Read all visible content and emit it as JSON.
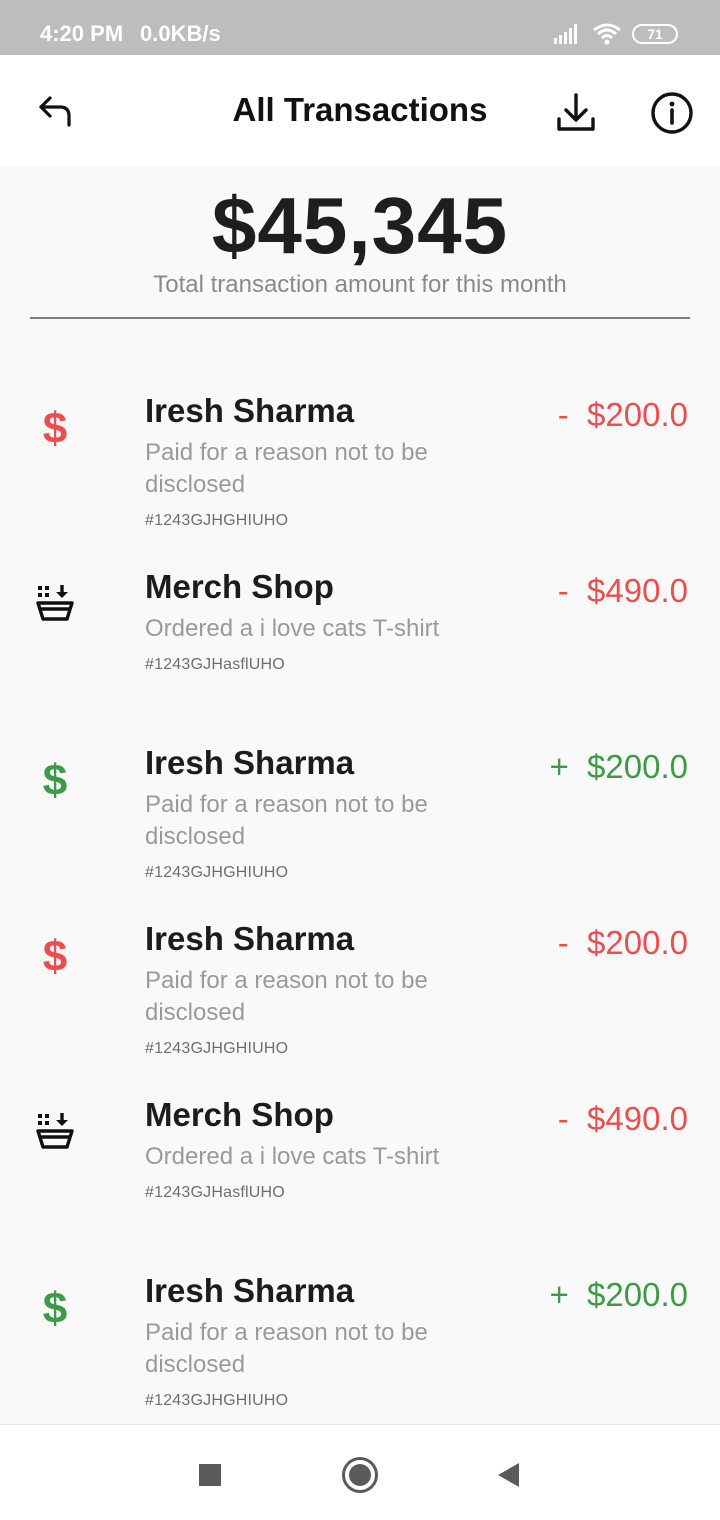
{
  "status_bar": {
    "time": "4:20 PM",
    "speed": "0.0KB/s",
    "battery": "71",
    "icons": [
      "signal-icon",
      "wifi-icon",
      "battery-icon"
    ]
  },
  "app_bar": {
    "title": "All Transactions",
    "icons": [
      "undo-back-icon",
      "download-icon",
      "info-icon"
    ]
  },
  "summary": {
    "total": "$45,345",
    "caption": "Total transaction amount for this month"
  },
  "colors": {
    "debit": "#ea4f4f",
    "credit": "#3d9b45",
    "status_bar_bg": "#bdbdbd"
  },
  "transactions": [
    {
      "icon": "dollar-icon",
      "icon_text": "$",
      "type": "debit",
      "name": "Iresh Sharma",
      "description": "Paid for a reason not to be disclosed",
      "ref": "#1243GJHGHIUHO",
      "amount": "-  $200.0"
    },
    {
      "icon": "shopping-basket-icon",
      "type": "debit",
      "name": "Merch Shop",
      "description": "Ordered a i love cats T-shirt",
      "ref": "#1243GJHasflUHO",
      "amount": "-  $490.0"
    },
    {
      "icon": "dollar-icon",
      "icon_text": "$",
      "type": "credit",
      "name": "Iresh Sharma",
      "description": "Paid for a reason not to be disclosed",
      "ref": "#1243GJHGHIUHO",
      "amount": "+  $200.0"
    },
    {
      "icon": "dollar-icon",
      "icon_text": "$",
      "type": "debit",
      "name": "Iresh Sharma",
      "description": "Paid for a reason not to be disclosed",
      "ref": "#1243GJHGHIUHO",
      "amount": "-  $200.0"
    },
    {
      "icon": "shopping-basket-icon",
      "type": "debit",
      "name": "Merch Shop",
      "description": "Ordered a i love cats T-shirt",
      "ref": "#1243GJHasflUHO",
      "amount": "-  $490.0"
    },
    {
      "icon": "dollar-icon",
      "icon_text": "$",
      "type": "credit",
      "name": "Iresh Sharma",
      "description": "Paid for a reason not to be disclosed",
      "ref": "#1243GJHGHIUHO",
      "amount": "+  $200.0"
    }
  ],
  "nav_bar": {
    "icons": [
      "recents-square-icon",
      "home-circle-icon",
      "back-triangle-icon"
    ]
  }
}
